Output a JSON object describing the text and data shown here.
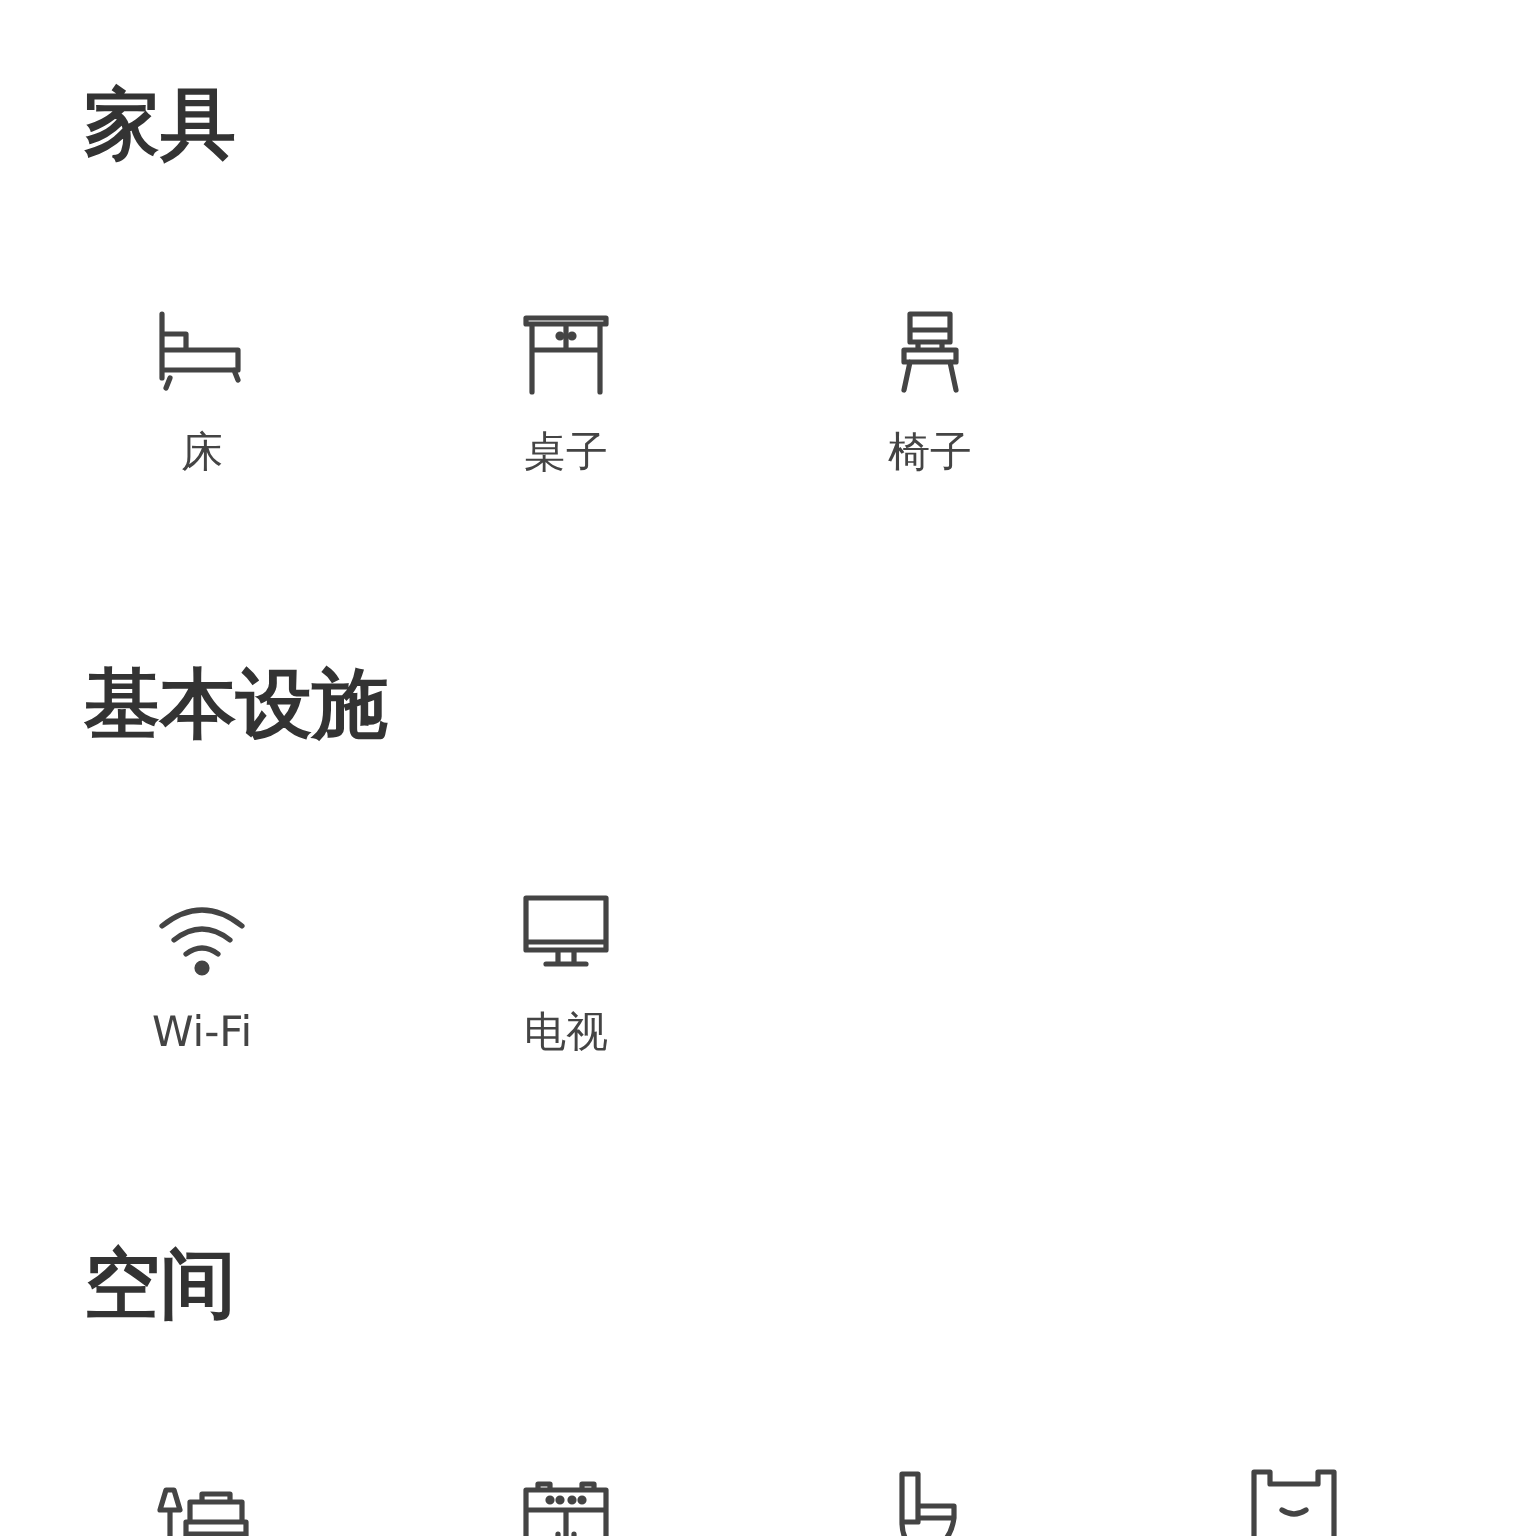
{
  "sections": [
    {
      "title": "家具",
      "items": [
        {
          "kind": "bed",
          "label": "床"
        },
        {
          "kind": "desk",
          "label": "桌子"
        },
        {
          "kind": "chair",
          "label": "椅子"
        }
      ]
    },
    {
      "title": "基本设施",
      "items": [
        {
          "kind": "wifi",
          "label": "Wi-Fi"
        },
        {
          "kind": "tv",
          "label": "电视"
        }
      ]
    },
    {
      "title": "空间",
      "items": [
        {
          "kind": "bedroom"
        },
        {
          "kind": "kitchen"
        },
        {
          "kind": "toilet"
        },
        {
          "kind": "bathtub"
        }
      ]
    }
  ]
}
